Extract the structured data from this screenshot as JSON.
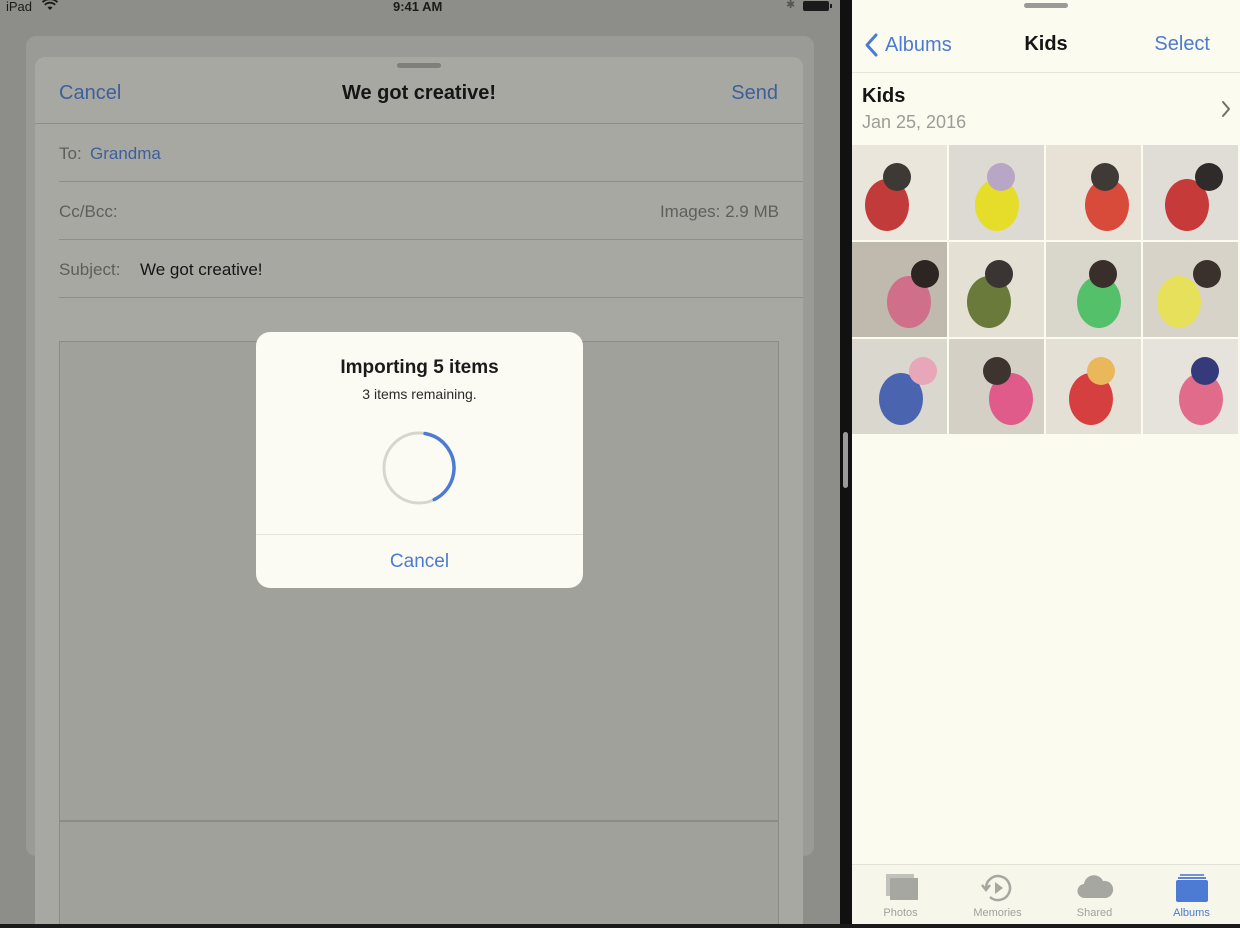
{
  "status_bar": {
    "carrier": "iPad",
    "time": "9:41 AM"
  },
  "compose": {
    "cancel_label": "Cancel",
    "title": "We got creative!",
    "send_label": "Send",
    "to_label": "To:",
    "to_value": "Grandma",
    "cc_label": "Cc/Bcc:",
    "images_info": "Images:  2.9 MB",
    "subject_label": "Subject:",
    "subject_value": "We got creative!"
  },
  "dialog": {
    "title": "Importing 5 items",
    "message": "3 items remaining.",
    "progress": 0.4,
    "cancel_label": "Cancel"
  },
  "photos": {
    "nav": {
      "back_label": "Albums",
      "title": "Kids",
      "select_label": "Select"
    },
    "album": {
      "name": "Kids",
      "date": "Jan 25, 2016"
    },
    "grid_count": 12,
    "tabs": [
      {
        "label": "Photos",
        "icon": "photos-icon",
        "active": false
      },
      {
        "label": "Memories",
        "icon": "memories-icon",
        "active": false
      },
      {
        "label": "Shared",
        "icon": "cloud-icon",
        "active": false
      },
      {
        "label": "Albums",
        "icon": "albums-icon",
        "active": true
      }
    ]
  },
  "colors": {
    "accent": "#4d7ad2",
    "dim_accent": "#3d5f9d",
    "pane_bg": "#fbfbef"
  }
}
